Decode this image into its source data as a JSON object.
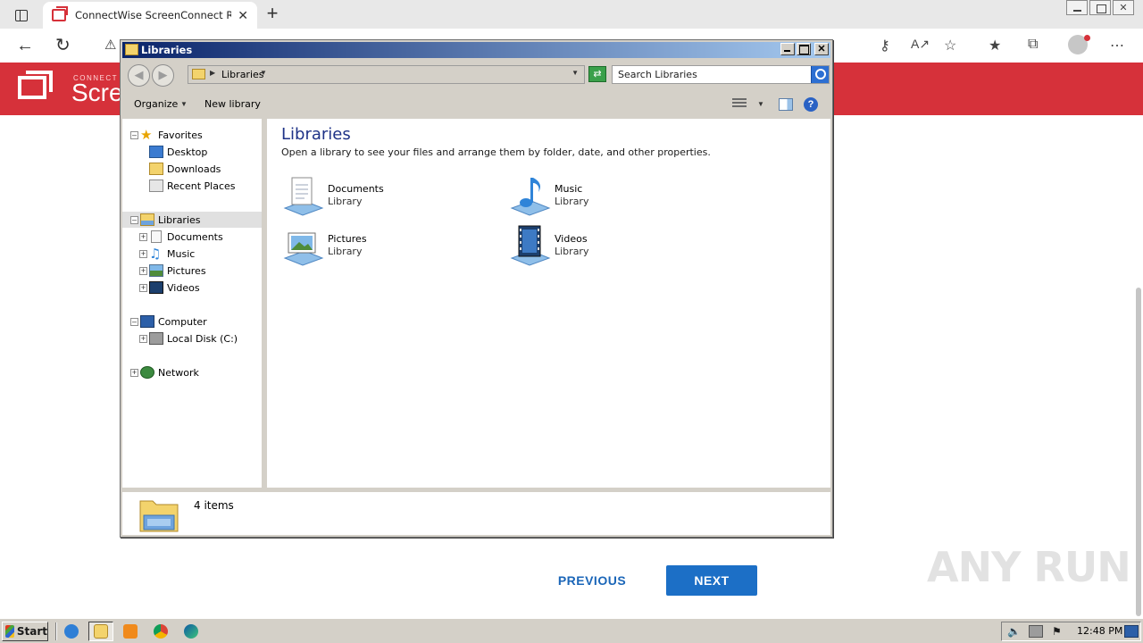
{
  "browser": {
    "tab_title": "ConnectWise ScreenConnect Remote",
    "close_tab": "✕",
    "new_tab": "+"
  },
  "site": {
    "brand_small": "CONNECT",
    "brand": "Scre"
  },
  "wizard": {
    "previous_label": "PREVIOUS",
    "next_label": "NEXT"
  },
  "watermark": "ANY RUN",
  "explorer": {
    "title": "Libraries",
    "address": "Libraries",
    "search_placeholder": "Search Libraries",
    "commands": {
      "organize": "Organize",
      "new_library": "New library"
    },
    "tree": {
      "favorites": "Favorites",
      "desktop": "Desktop",
      "downloads": "Downloads",
      "recent_places": "Recent Places",
      "libraries": "Libraries",
      "documents": "Documents",
      "music": "Music",
      "pictures": "Pictures",
      "videos": "Videos",
      "computer": "Computer",
      "local_disk": "Local Disk (C:)",
      "network": "Network"
    },
    "content": {
      "title": "Libraries",
      "subtitle": "Open a library to see your files and arrange them by folder, date, and other properties.",
      "libraries": [
        {
          "name": "Documents",
          "type": "Library",
          "icon": "documents-library-icon"
        },
        {
          "name": "Music",
          "type": "Library",
          "icon": "music-library-icon"
        },
        {
          "name": "Pictures",
          "type": "Library",
          "icon": "pictures-library-icon"
        },
        {
          "name": "Videos",
          "type": "Library",
          "icon": "videos-library-icon"
        }
      ]
    },
    "details": {
      "item_count": "4 items"
    }
  },
  "taskbar": {
    "start_label": "Start",
    "clock": "12:48 PM"
  },
  "colors": {
    "brand_red": "#d6313a",
    "next_button": "#1c6fc6",
    "title_gradient_start": "#0a246a",
    "title_gradient_end": "#a6caf0"
  }
}
